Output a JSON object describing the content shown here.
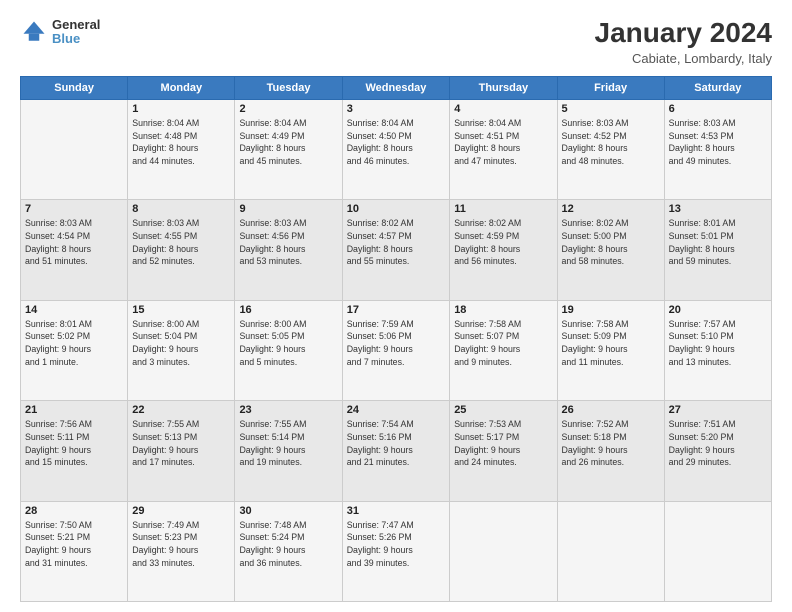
{
  "header": {
    "logo_general": "General",
    "logo_blue": "Blue",
    "title": "January 2024",
    "subtitle": "Cabiate, Lombardy, Italy"
  },
  "columns": [
    "Sunday",
    "Monday",
    "Tuesday",
    "Wednesday",
    "Thursday",
    "Friday",
    "Saturday"
  ],
  "weeks": [
    [
      {
        "num": "",
        "info": ""
      },
      {
        "num": "1",
        "info": "Sunrise: 8:04 AM\nSunset: 4:48 PM\nDaylight: 8 hours\nand 44 minutes."
      },
      {
        "num": "2",
        "info": "Sunrise: 8:04 AM\nSunset: 4:49 PM\nDaylight: 8 hours\nand 45 minutes."
      },
      {
        "num": "3",
        "info": "Sunrise: 8:04 AM\nSunset: 4:50 PM\nDaylight: 8 hours\nand 46 minutes."
      },
      {
        "num": "4",
        "info": "Sunrise: 8:04 AM\nSunset: 4:51 PM\nDaylight: 8 hours\nand 47 minutes."
      },
      {
        "num": "5",
        "info": "Sunrise: 8:03 AM\nSunset: 4:52 PM\nDaylight: 8 hours\nand 48 minutes."
      },
      {
        "num": "6",
        "info": "Sunrise: 8:03 AM\nSunset: 4:53 PM\nDaylight: 8 hours\nand 49 minutes."
      }
    ],
    [
      {
        "num": "7",
        "info": "Sunrise: 8:03 AM\nSunset: 4:54 PM\nDaylight: 8 hours\nand 51 minutes."
      },
      {
        "num": "8",
        "info": "Sunrise: 8:03 AM\nSunset: 4:55 PM\nDaylight: 8 hours\nand 52 minutes."
      },
      {
        "num": "9",
        "info": "Sunrise: 8:03 AM\nSunset: 4:56 PM\nDaylight: 8 hours\nand 53 minutes."
      },
      {
        "num": "10",
        "info": "Sunrise: 8:02 AM\nSunset: 4:57 PM\nDaylight: 8 hours\nand 55 minutes."
      },
      {
        "num": "11",
        "info": "Sunrise: 8:02 AM\nSunset: 4:59 PM\nDaylight: 8 hours\nand 56 minutes."
      },
      {
        "num": "12",
        "info": "Sunrise: 8:02 AM\nSunset: 5:00 PM\nDaylight: 8 hours\nand 58 minutes."
      },
      {
        "num": "13",
        "info": "Sunrise: 8:01 AM\nSunset: 5:01 PM\nDaylight: 8 hours\nand 59 minutes."
      }
    ],
    [
      {
        "num": "14",
        "info": "Sunrise: 8:01 AM\nSunset: 5:02 PM\nDaylight: 9 hours\nand 1 minute."
      },
      {
        "num": "15",
        "info": "Sunrise: 8:00 AM\nSunset: 5:04 PM\nDaylight: 9 hours\nand 3 minutes."
      },
      {
        "num": "16",
        "info": "Sunrise: 8:00 AM\nSunset: 5:05 PM\nDaylight: 9 hours\nand 5 minutes."
      },
      {
        "num": "17",
        "info": "Sunrise: 7:59 AM\nSunset: 5:06 PM\nDaylight: 9 hours\nand 7 minutes."
      },
      {
        "num": "18",
        "info": "Sunrise: 7:58 AM\nSunset: 5:07 PM\nDaylight: 9 hours\nand 9 minutes."
      },
      {
        "num": "19",
        "info": "Sunrise: 7:58 AM\nSunset: 5:09 PM\nDaylight: 9 hours\nand 11 minutes."
      },
      {
        "num": "20",
        "info": "Sunrise: 7:57 AM\nSunset: 5:10 PM\nDaylight: 9 hours\nand 13 minutes."
      }
    ],
    [
      {
        "num": "21",
        "info": "Sunrise: 7:56 AM\nSunset: 5:11 PM\nDaylight: 9 hours\nand 15 minutes."
      },
      {
        "num": "22",
        "info": "Sunrise: 7:55 AM\nSunset: 5:13 PM\nDaylight: 9 hours\nand 17 minutes."
      },
      {
        "num": "23",
        "info": "Sunrise: 7:55 AM\nSunset: 5:14 PM\nDaylight: 9 hours\nand 19 minutes."
      },
      {
        "num": "24",
        "info": "Sunrise: 7:54 AM\nSunset: 5:16 PM\nDaylight: 9 hours\nand 21 minutes."
      },
      {
        "num": "25",
        "info": "Sunrise: 7:53 AM\nSunset: 5:17 PM\nDaylight: 9 hours\nand 24 minutes."
      },
      {
        "num": "26",
        "info": "Sunrise: 7:52 AM\nSunset: 5:18 PM\nDaylight: 9 hours\nand 26 minutes."
      },
      {
        "num": "27",
        "info": "Sunrise: 7:51 AM\nSunset: 5:20 PM\nDaylight: 9 hours\nand 29 minutes."
      }
    ],
    [
      {
        "num": "28",
        "info": "Sunrise: 7:50 AM\nSunset: 5:21 PM\nDaylight: 9 hours\nand 31 minutes."
      },
      {
        "num": "29",
        "info": "Sunrise: 7:49 AM\nSunset: 5:23 PM\nDaylight: 9 hours\nand 33 minutes."
      },
      {
        "num": "30",
        "info": "Sunrise: 7:48 AM\nSunset: 5:24 PM\nDaylight: 9 hours\nand 36 minutes."
      },
      {
        "num": "31",
        "info": "Sunrise: 7:47 AM\nSunset: 5:26 PM\nDaylight: 9 hours\nand 39 minutes."
      },
      {
        "num": "",
        "info": ""
      },
      {
        "num": "",
        "info": ""
      },
      {
        "num": "",
        "info": ""
      }
    ]
  ]
}
